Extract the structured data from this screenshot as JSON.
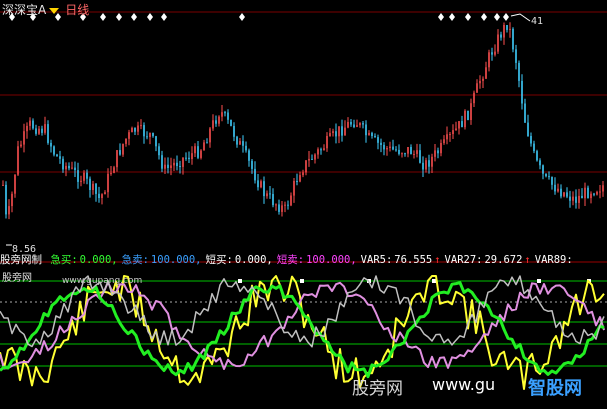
{
  "header": {
    "stock_name": "深深宝A",
    "period": "日线"
  },
  "price_panel": {
    "high_label": "41",
    "low_label": "8.56",
    "buy_signal_count": 6,
    "colors": {
      "up": "#ff5050",
      "down": "#40d0ff",
      "grid": "#7a0000",
      "signal": "#ffffff"
    }
  },
  "indicator_bar": {
    "title": "股旁网制",
    "items": [
      {
        "label": "急买:",
        "value": "0.000,",
        "color": "#33ff33"
      },
      {
        "label": "急卖:",
        "value": "100.000,",
        "color": "#3aa0ff"
      },
      {
        "label": "短买:",
        "value": "0.000,",
        "color": "#ffffff"
      },
      {
        "label": "短卖:",
        "value": "100.000,",
        "color": "#ff44ff"
      },
      {
        "label": "VAR5:",
        "value": "76.555",
        "color": "#ffffff",
        "arrow": "↑"
      },
      {
        "label": "VAR27:",
        "value": "29.672",
        "color": "#ffffff",
        "arrow": "↑"
      },
      {
        "label": "VAR89:",
        "value": "",
        "color": "#ffffff",
        "arrow": ""
      }
    ]
  },
  "watermarks": {
    "panel_name": "股旁网",
    "url": "www.gupang.com",
    "footer_left": "股旁网",
    "footer_url": "www.gu",
    "footer_logo": "智股网"
  },
  "lines": {
    "green": "#22ee22",
    "yellow": "#ffff33",
    "pink": "#e090e0",
    "grey": "#c0c0c0",
    "guide": "#00c000"
  }
}
